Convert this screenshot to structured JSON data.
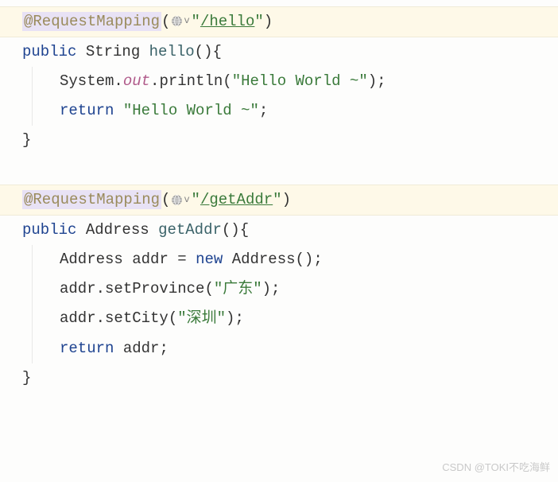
{
  "method1": {
    "annotation": "@RequestMapping",
    "path": "/hello",
    "modifier": "public",
    "returnType": "String",
    "name": "hello",
    "body": {
      "sysout_class": "System",
      "sysout_field": "out",
      "sysout_method": "println",
      "sysout_arg": "\"Hello World ~\"",
      "return_kw": "return",
      "return_val": "\"Hello World ~\""
    }
  },
  "method2": {
    "annotation": "@RequestMapping",
    "path": "/getAddr",
    "modifier": "public",
    "returnType": "Address",
    "name": "getAddr",
    "body": {
      "varType": "Address",
      "varName": "addr",
      "newKw": "new",
      "ctor": "Address",
      "setProvince_call": "addr.setProvince",
      "setProvince_arg": "\"广东\"",
      "setCity_call": "addr.setCity",
      "setCity_arg": "\"深圳\"",
      "return_kw": "return",
      "return_val": "addr"
    }
  },
  "watermark": "CSDN @TOKI不吃海鲜"
}
